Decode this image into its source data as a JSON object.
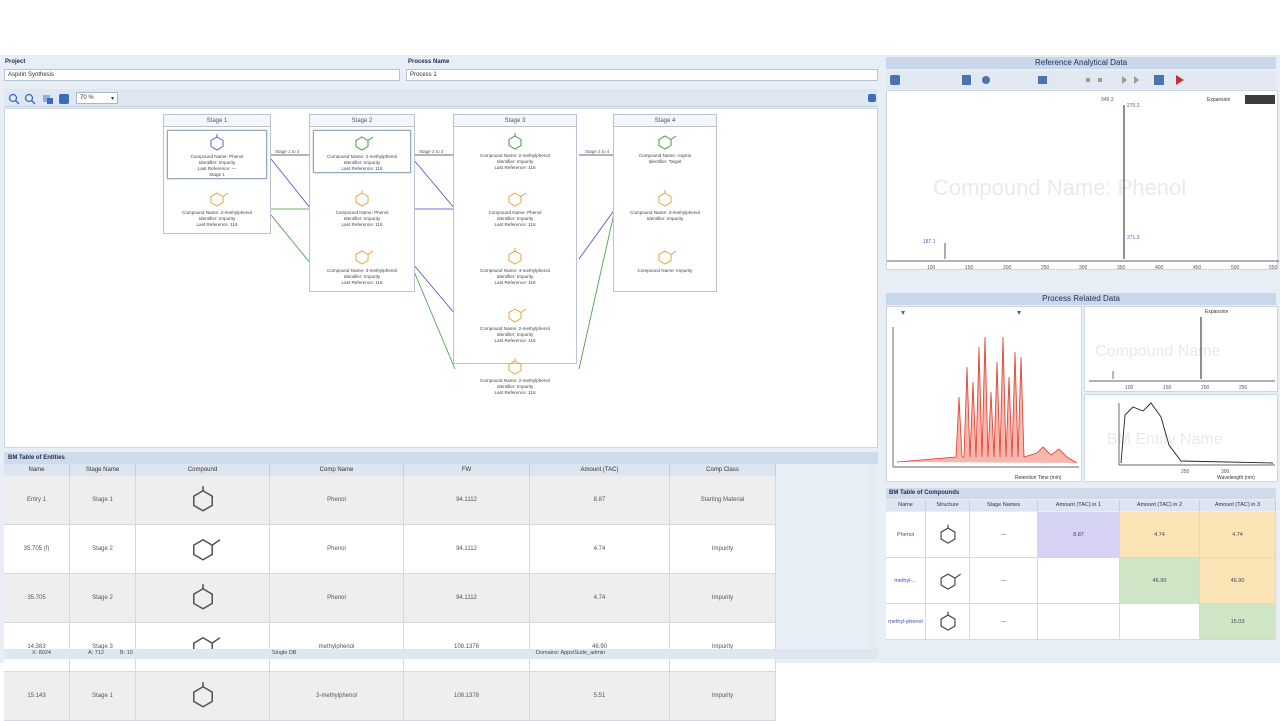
{
  "header": {
    "project_label": "Project",
    "project_value": "Aspirin Synthesis",
    "process_label": "Process Name",
    "process_value": "Process 1"
  },
  "toolbar": {
    "zoom": "70 %"
  },
  "stages": [
    {
      "title": "Stage 1",
      "compounds": [
        {
          "text": [
            "Compound Name: Phenol",
            "Identifier: Impurity",
            "Last Reference: —",
            "Stage 1"
          ],
          "color": "#5b5fd6",
          "selected": true
        },
        {
          "text": [
            "Compound Name: 2-methylphenol",
            "Identifier: Impurity",
            "Last Reference: 116"
          ],
          "color": "#e8a43b",
          "selected": false
        }
      ]
    },
    {
      "title": "Stage 2",
      "compounds": [
        {
          "text": [
            "Compound Name: 2-methylphenol",
            "Identifier: Impurity",
            "Last Reference: 116"
          ],
          "color": "#3f9a3f",
          "selected": true
        },
        {
          "text": [
            "Compound Name: Phenol",
            "Identifier: Impurity",
            "Last Reference: 116"
          ],
          "color": "#e8a43b",
          "selected": false
        },
        {
          "text": [
            "Compound Name: 3-methylphenol",
            "Identifier: Impurity",
            "Last Reference: 116"
          ],
          "color": "#e8a43b",
          "selected": false
        }
      ]
    },
    {
      "title": "Stage 3",
      "compounds": [
        {
          "text": [
            "Compound Name: 2-methylphenol",
            "Identifier: Impurity",
            "Last Reference: 116"
          ],
          "color": "#3f9a3f",
          "selected": false
        },
        {
          "text": [
            "Compound Name: Phenol",
            "Identifier: Impurity",
            "Last Reference: 116"
          ],
          "color": "#e8a43b",
          "selected": false
        },
        {
          "text": [
            "Compound Name: 4-methylphenol",
            "Identifier: Impurity",
            "Last Reference: 116"
          ],
          "color": "#e8a43b",
          "selected": false
        },
        {
          "text": [
            "Compound Name: 2-methylphenol",
            "Identifier: Impurity",
            "Last Reference: 116"
          ],
          "color": "#e8a43b",
          "selected": false
        },
        {
          "text": [
            "Compound Name: 2-methylphenol",
            "Identifier: Impurity",
            "Last Reference: 116"
          ],
          "color": "#e8a43b",
          "selected": false
        }
      ]
    },
    {
      "title": "Stage 4",
      "compounds": [
        {
          "text": [
            "Compound Name: Aspirin",
            "Identifier: Target"
          ],
          "color": "#3f9a3f",
          "selected": false
        },
        {
          "text": [
            "Compound Name: 3-methylphenol",
            "Identifier: Impurity"
          ],
          "color": "#e8a43b",
          "selected": false
        },
        {
          "text": [
            "Compound Name: Impurity"
          ],
          "color": "#e8a43b",
          "selected": false
        }
      ]
    }
  ],
  "arrow_labels": [
    "Stage 1 to 2",
    "Stage 2 to 3",
    "Stage 3 to 4"
  ],
  "entities_table": {
    "title": "BM Table of Entities",
    "headers": [
      "Name",
      "Stage Name",
      "Compound",
      "Comp Name",
      "FW",
      "Amount (TAC)",
      "Comp Class"
    ],
    "rows": [
      {
        "name": "Entry 1",
        "stage": "Stage 1",
        "comp": "Phenol",
        "fw": "94.1112",
        "amount": "8.87",
        "class": "Starting Material"
      },
      {
        "name": "35.705 (f)",
        "stage": "Stage 2",
        "comp": "Phenol",
        "fw": "94.1112",
        "amount": "4.74",
        "class": "Impurity"
      },
      {
        "name": "35.705",
        "stage": "Stage 2",
        "comp": "Phenol",
        "fw": "94.1112",
        "amount": "4.74",
        "class": "Impurity"
      },
      {
        "name": "14.383",
        "stage": "Stage 3",
        "comp": "methylphenol",
        "fw": "108.1378",
        "amount": "46.90",
        "class": "Impurity"
      },
      {
        "name": "15.143",
        "stage": "Stage 1",
        "comp": "3-methylphenol",
        "fw": "108.1378",
        "amount": "5.51",
        "class": "Impurity"
      }
    ]
  },
  "status_bar": {
    "left": "X: 8024",
    "left2": "A: 712",
    "left3": "B: 10",
    "mid": "Single DB",
    "right": "Domains: Apps\\Suite_admin"
  },
  "reference_panel": {
    "title": "Reference Analytical Data",
    "watermark": "Compound Name: Phenol",
    "expansion": "Expansion",
    "peak_labels": [
      "948.3",
      "270.3",
      "271.3",
      "187.1"
    ],
    "x_ticks": [
      "100",
      "150",
      "200",
      "250",
      "300",
      "350",
      "400",
      "450",
      "500",
      "550"
    ]
  },
  "process_panel": {
    "title": "Process Related Data",
    "watermark1": "Compound Name",
    "watermark2": "BM Entity Name",
    "xlabel": "Retention Time (min)",
    "wavelength_label": "Wavelength (nm)",
    "uv_ticks": [
      "250",
      "300"
    ],
    "ms_ticks": [
      "100",
      "150",
      "200",
      "250"
    ]
  },
  "compounds_table": {
    "title": "BM Table of Compounds",
    "headers": [
      "Name",
      "Structure",
      "Stage Names",
      "Amount (TAC) in 1",
      "Amount (TAC) in 2",
      "Amount (TAC) in 3"
    ],
    "rows": [
      {
        "name": "Phenol",
        "stages": "—",
        "a1": "8.87",
        "a2": "4.74",
        "a3": "4.74"
      },
      {
        "name": "methyl-...",
        "stages": "—",
        "a1": "",
        "a2": "46.90",
        "a3": "46.90"
      },
      {
        "name": "methyl-phenol",
        "stages": "—",
        "a1": "",
        "a2": "",
        "a3": "15.03"
      }
    ]
  },
  "colors": {
    "accent": "#1b2f50",
    "peak": "#e23a2a",
    "green_cell": "#cfe6c6",
    "orange_cell": "#fae3b4",
    "purple_cell": "#d7d3f5"
  }
}
